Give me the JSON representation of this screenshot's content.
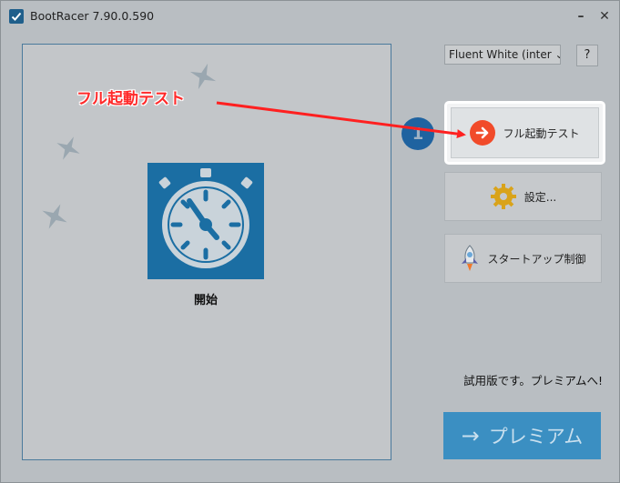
{
  "window": {
    "title": "BootRacer 7.90.0.590",
    "minimize_glyph": "–",
    "close_glyph": "✕"
  },
  "main": {
    "start_label": "開始"
  },
  "toolbar": {
    "theme_value": "Fluent White (inter ⌄",
    "help_label": "?"
  },
  "step_badge": "1",
  "buttons": {
    "full_boot_test": "フル起動テスト",
    "settings": "設定...",
    "startup_control": "スタートアップ制御"
  },
  "trial_text": "試用版です。プレミアムへ!",
  "premium": {
    "arrow": "→",
    "label": "プレミアム"
  },
  "annotation": {
    "label": "フル起動テスト"
  },
  "colors": {
    "accent_blue": "#1b6ea3",
    "premium_blue": "#3b8fc2",
    "annotation_red": "#ff2a2a",
    "arrow_orange": "#f14b2a"
  },
  "icons": {
    "app": "checkmark-icon",
    "clock": "stopwatch-icon",
    "settings": "gear-icon",
    "startup": "rocket-icon",
    "full_boot": "arrow-right-circle-icon"
  }
}
